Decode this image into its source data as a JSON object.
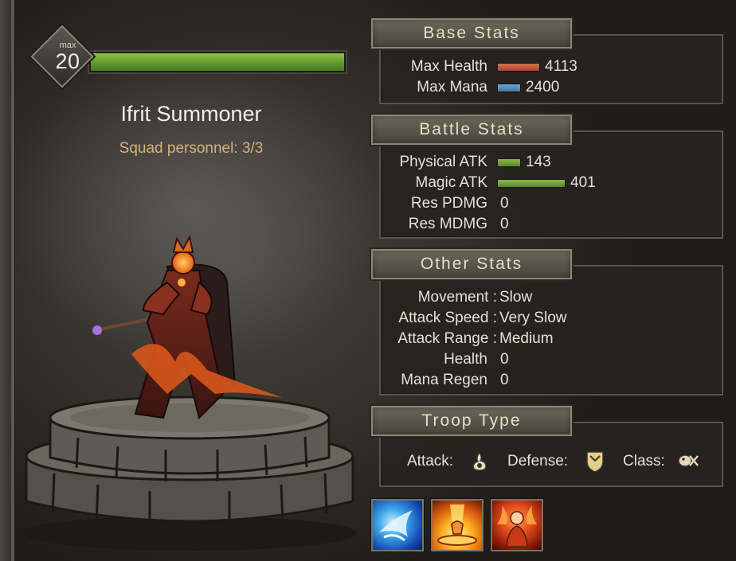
{
  "unit": {
    "level_cap_label": "max",
    "level": "20",
    "level_progress": 1.0,
    "name": "Ifrit Summoner",
    "squad_personnel": "Squad personnel: 3/3"
  },
  "base_stats": {
    "title": "Base Stats",
    "rows": [
      {
        "label": "Max Health",
        "value": "4113",
        "bar_fraction": 0.33,
        "bar_color": "#c1603e"
      },
      {
        "label": "Max Mana",
        "value": "2400",
        "bar_fraction": 0.2,
        "bar_color": "#5692bd"
      }
    ]
  },
  "battle_stats": {
    "title": "Battle Stats",
    "rows": [
      {
        "label": "Physical ATK",
        "value": "143",
        "bar_fraction": 0.2,
        "bar_color": "#77a23c"
      },
      {
        "label": "Magic ATK",
        "value": "401",
        "bar_fraction": 0.57,
        "bar_color": "#77a23c"
      },
      {
        "label": "Res PDMG",
        "value": "0"
      },
      {
        "label": "Res MDMG",
        "value": "0"
      }
    ]
  },
  "other_stats": {
    "title": "Other Stats",
    "rows": [
      {
        "label": "Movement :",
        "value": "Slow"
      },
      {
        "label": "Attack Speed :",
        "value": "Very Slow"
      },
      {
        "label": "Attack Range :",
        "value": "Medium"
      },
      {
        "label": "Health",
        "value": "0"
      },
      {
        "label": "Mana Regen",
        "value": "0"
      }
    ]
  },
  "troop_type": {
    "title": "Troop Type",
    "attack_label": "Attack:",
    "attack_icon": "magic-attack-icon",
    "defense_label": "Defense:",
    "defense_icon": "shield-icon",
    "class_label": "Class:",
    "class_icon": "summoner-class-icon"
  },
  "skills": [
    {
      "icon": "ice-claw-skill-icon"
    },
    {
      "icon": "flame-pillar-skill-icon"
    },
    {
      "icon": "fire-aura-skill-icon"
    }
  ],
  "colors": {
    "level_bar": "#6aa533",
    "panel_title": "#e8ddc8",
    "squad_text": "#d6b07c"
  }
}
